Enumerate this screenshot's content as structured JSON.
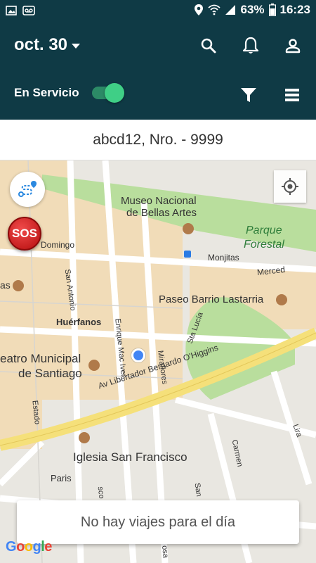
{
  "status_bar": {
    "battery": "63%",
    "time": "16:23"
  },
  "header": {
    "date_label": "oct. 30",
    "service_label": "En Servicio",
    "service_on": true
  },
  "trip": {
    "title": "abcd12, Nro. - 9999"
  },
  "map": {
    "labels": {
      "museo": "Museo Nacional",
      "museo2": "de Bellas Artes",
      "parque": "Parque",
      "forestal": "Forestal",
      "domingo": "Domingo",
      "monjitas": "Monjitas",
      "merced": "Merced",
      "san_antonio": "San Antonio",
      "as": "as",
      "paseo": "Paseo Barrio Lastarria",
      "huerfanos": "Huérfanos",
      "enrique": "Enrique Mac Iver",
      "sta_lucia": "Sta Lucía",
      "miraflores": "Miraflores",
      "teatro": "eatro Municipal",
      "teatro2": "de Santiago",
      "estado": "Estado",
      "alameda": "Av Libertador Bernardo O'Higgins",
      "lira": "Lira",
      "carmen": "Carmen",
      "iglesia": "Iglesia San Francisco",
      "paris": "Paris",
      "sco": "sco",
      "san": "San",
      "osa": "osa"
    },
    "sos_label": "SOS",
    "google": [
      "G",
      "o",
      "o",
      "g",
      "l",
      "e"
    ]
  },
  "empty_message": "No hay viajes para el día",
  "colors": {
    "header_bg": "#0f3a45",
    "toggle_on": "#3fcf86",
    "park": "#b7dd9a",
    "block": "#f0d9b5",
    "road_major": "#f5e07a"
  }
}
